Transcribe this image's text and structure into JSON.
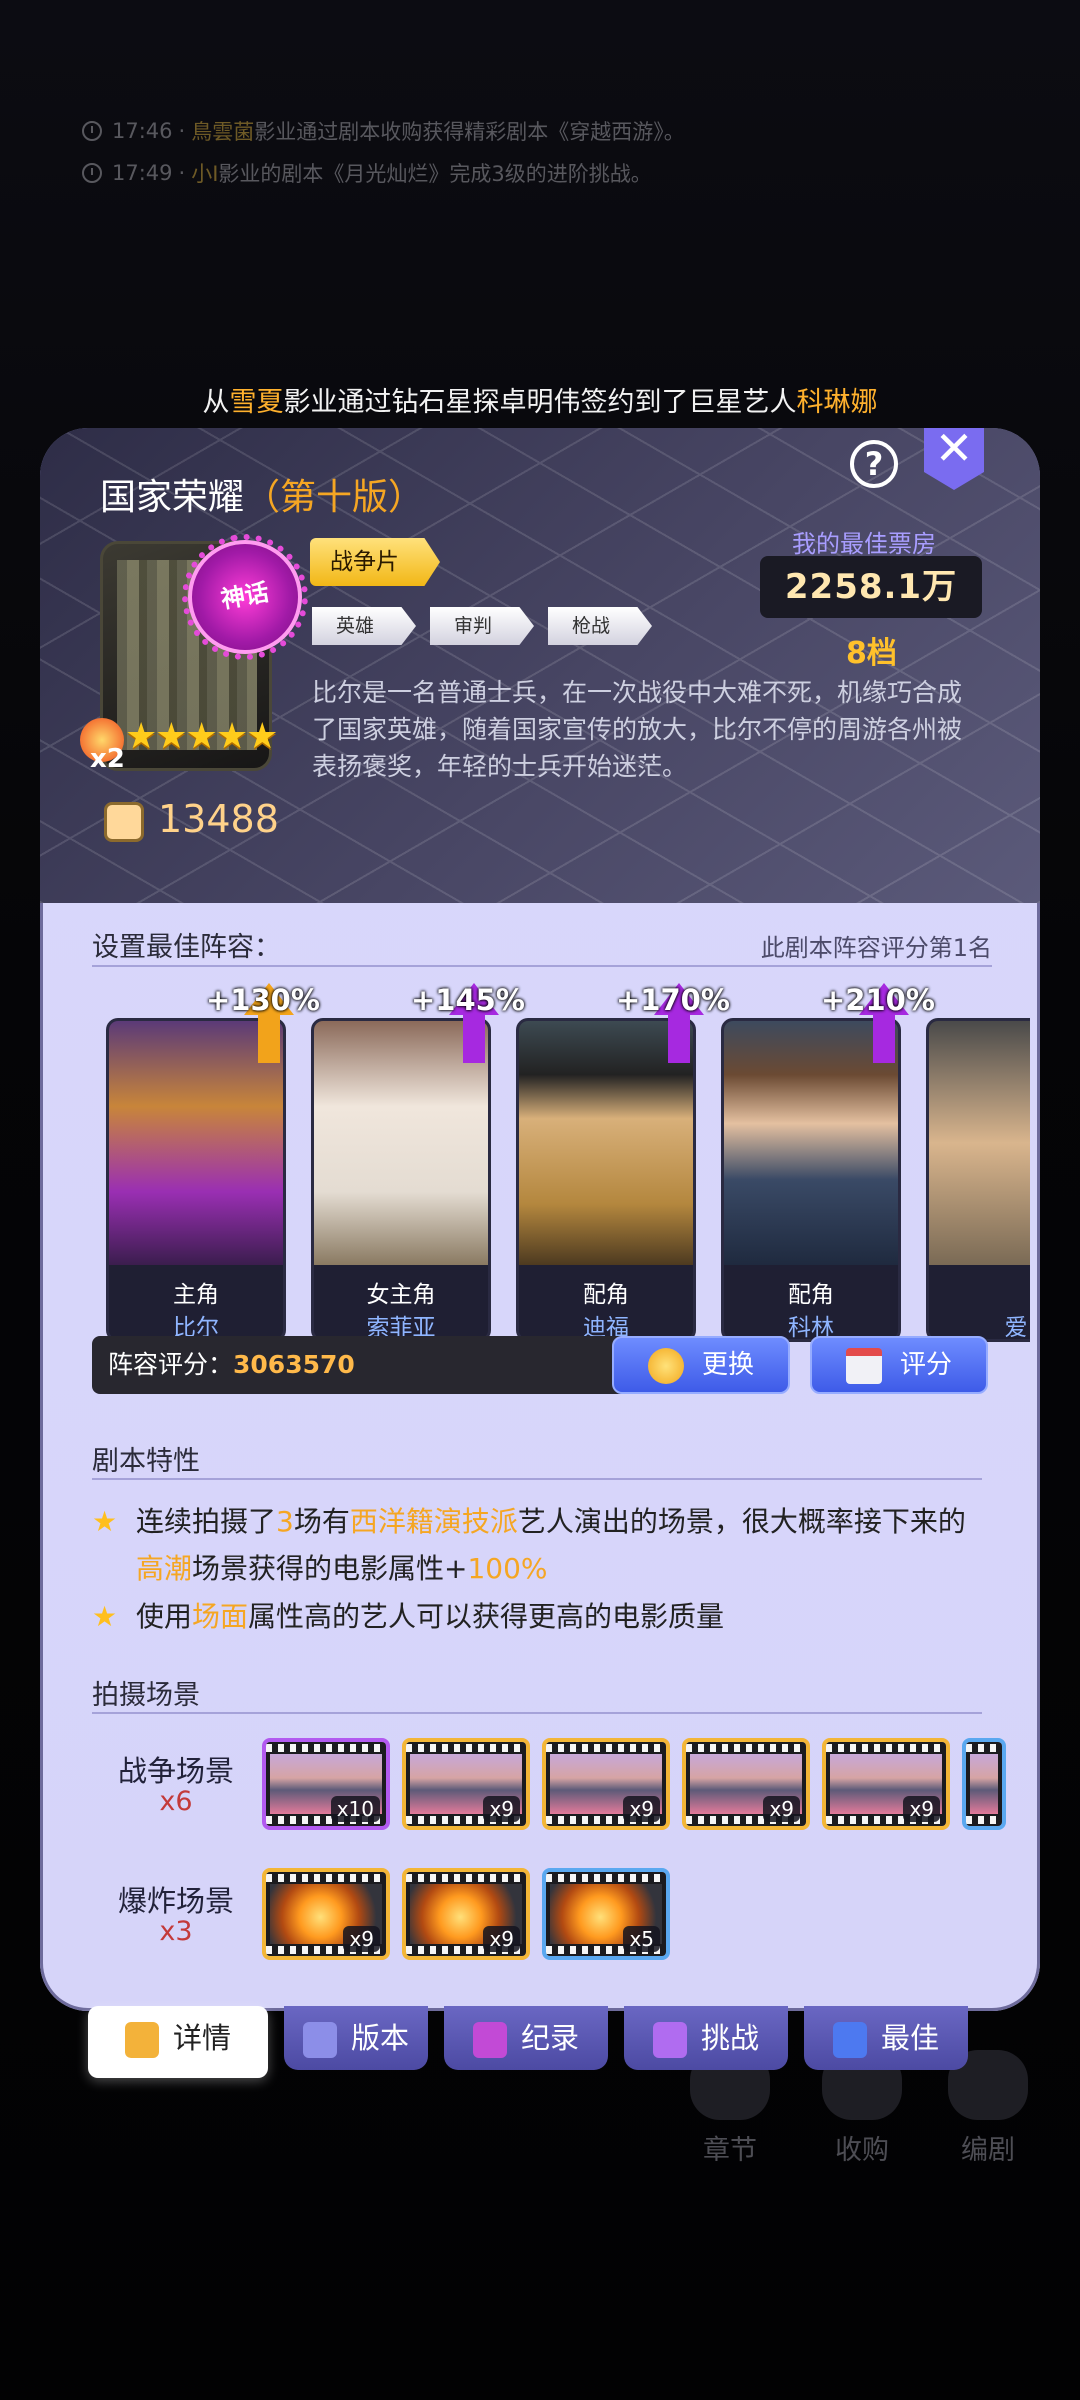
{
  "ticker": [
    {
      "time": "17:46",
      "sep": "·",
      "name": "鳥雲菌",
      "text": "影业通过剧本收购获得精彩剧本《穿越西游》。"
    },
    {
      "time": "17:49",
      "sep": "·",
      "name": "小I",
      "text": "影业的剧本《月光灿烂》完成3级的进阶挑战。"
    }
  ],
  "broadcast": {
    "p1": "从",
    "name1": "雪夏",
    "p2": "影业通过钻石星探卓明伟签约到了巨星艺人",
    "name2": "科琳娜"
  },
  "script": {
    "title": "国家荣耀",
    "version": "（第十版）",
    "badge": "神话",
    "multiplier": "x2",
    "stars": "★★★★★",
    "genre": "战争片",
    "tags": [
      "英雄",
      "审判",
      "枪战"
    ],
    "description": "比尔是一名普通士兵，在一次战役中大难不死，机缘巧合成了国家英雄，随着国家宣传的放大，比尔不停的周游各州被表扬褒奖，年轻的士兵开始迷茫。",
    "reads": "13488",
    "best_box_label": "我的最佳票房",
    "best_box_value": "2258.1万",
    "best_box_grade": "8档",
    "help": "?",
    "close": "✕"
  },
  "lineup": {
    "title": "设置最佳阵容：",
    "rank_note": "此剧本阵容评分第1名",
    "cards": [
      {
        "bonus": "+130%",
        "role": "主角",
        "name": "比尔",
        "arrow_color": "#f2a31b",
        "art": "linear-gradient(180deg,#5b3a78 0%,#c8853a 35%,#9a2fb3 70%,#3b1d4e 100%)"
      },
      {
        "bonus": "+145%",
        "role": "女主角",
        "name": "索菲亚",
        "arrow_color": "#a629e0",
        "art": "linear-gradient(180deg,#8b6a5a 0%,#f0e6dc 35%,#e4dcd2 70%,#8a7a62 100%)"
      },
      {
        "bonus": "+170%",
        "role": "配角",
        "name": "迪福",
        "arrow_color": "#a629e0",
        "art": "linear-gradient(180deg,#3d4a52 0%,#222 22%,#d8b07a 40%,#b4873e 75%,#4d3a20 100%)"
      },
      {
        "bonus": "+210%",
        "role": "配角",
        "name": "科林",
        "arrow_color": "#a629e0",
        "art": "linear-gradient(180deg,#3d4a5e 0%,#6b4a33 22%,#e4c0a0 42%,#3a4a66 65%,#1f2a3f 100%)"
      },
      {
        "bonus": "",
        "role": "",
        "name": "爱",
        "arrow_color": "#a629e0",
        "art": "linear-gradient(180deg,#4a4a4a 0%,#d9b58d 50%,#7a6a55 100%)"
      }
    ],
    "score_label": "阵容评分：",
    "score_value": "3063570",
    "replace_btn": "更换",
    "rate_btn": "评分"
  },
  "features": {
    "title": "剧本特性",
    "items": [
      {
        "p1": "连续拍摄了",
        "o1": "3",
        "p2": "场有",
        "o2": "西洋籍演技派",
        "p3": "艺人演出的场景，很大概率接下来的",
        "o3": "高潮",
        "p4": "场景获得的电影属性+",
        "o4": "100%"
      },
      {
        "p1": "使用",
        "o1": "场面",
        "p2": "属性高的艺人可以获得更高的电影质量"
      }
    ],
    "star": "★"
  },
  "scenes": {
    "title": "拍摄场景",
    "rows": [
      {
        "label": "战争场景",
        "count": "x6",
        "items": [
          {
            "q": "x10",
            "border": "purple",
            "pic": "linear-gradient(180deg,#c7a7d8 0%,#d6a4a4 40%,#5d5a78 60%,#e27a9a 100%)"
          },
          {
            "q": "x9",
            "border": "gold",
            "pic": "linear-gradient(180deg,#c7a7d8 0%,#d6a4a4 40%,#5d5a78 60%,#e27a9a 100%)"
          },
          {
            "q": "x9",
            "border": "gold",
            "pic": "linear-gradient(180deg,#c7a7d8 0%,#d6a4a4 40%,#5d5a78 60%,#e27a9a 100%)"
          },
          {
            "q": "x9",
            "border": "gold",
            "pic": "linear-gradient(180deg,#c7a7d8 0%,#d6a4a4 40%,#5d5a78 60%,#e27a9a 100%)"
          },
          {
            "q": "x9",
            "border": "gold",
            "pic": "linear-gradient(180deg,#c7a7d8 0%,#d6a4a4 40%,#5d5a78 60%,#e27a9a 100%)"
          },
          {
            "q": "",
            "border": "blue",
            "pic": "linear-gradient(180deg,#c7a7d8 0%,#d6a4a4 40%,#5d5a78 60%,#e27a9a 100%)"
          }
        ]
      },
      {
        "label": "爆炸场景",
        "count": "x3",
        "items": [
          {
            "q": "x9",
            "border": "gold",
            "pic": "radial-gradient(circle at 45% 55%,#ffe07a 0%,#ff9a1f 30%,#b24a12 55%,#33343c 80%)"
          },
          {
            "q": "x9",
            "border": "gold",
            "pic": "radial-gradient(circle at 45% 55%,#ffe07a 0%,#ff9a1f 30%,#b24a12 55%,#33343c 80%)"
          },
          {
            "q": "x5",
            "border": "blue",
            "pic": "radial-gradient(circle at 45% 55%,#ffe07a 0%,#ff9a1f 30%,#b24a12 55%,#33343c 80%)"
          }
        ]
      }
    ]
  },
  "tabs": [
    {
      "label": "详情",
      "active": true,
      "icon_color": "#f3b23a"
    },
    {
      "label": "版本",
      "active": false,
      "icon_color": "#8c8ee8"
    },
    {
      "label": "纪录",
      "active": false,
      "icon_color": "#c24ad6"
    },
    {
      "label": "挑战",
      "active": false,
      "icon_color": "#b06cf0"
    },
    {
      "label": "最佳",
      "active": false,
      "icon_color": "#4d79f0"
    }
  ],
  "bg_nav": [
    "章节",
    "收购",
    "编剧"
  ]
}
